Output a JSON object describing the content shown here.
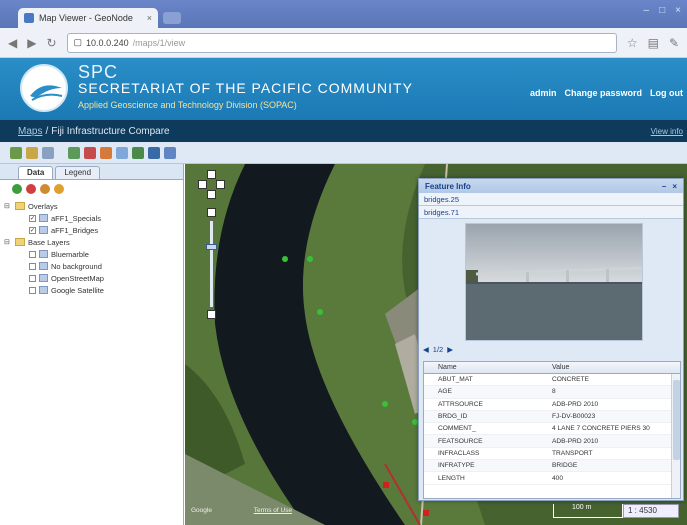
{
  "browser": {
    "tab_title": "Map Viewer - GeoNode",
    "tab_close": "×",
    "url_host": "10.0.0.240",
    "url_path": "/maps/1/view",
    "window_controls": [
      "–",
      "□",
      "×"
    ]
  },
  "banner": {
    "abbr": "SPC",
    "name": "Secretariat of the Pacific Community",
    "division": "Applied Geoscience and Technology Division (SOPAC)",
    "user_links": [
      "admin",
      "Change password",
      "Log out"
    ]
  },
  "breadcrumb": {
    "root": "Maps",
    "separator": "/",
    "current": "Fiji Infrastructure Compare",
    "right_link": "View info"
  },
  "left_panel": {
    "tabs": [
      "Data",
      "Legend"
    ],
    "tree": [
      {
        "label": "Overlays",
        "level": 0,
        "type": "folder"
      },
      {
        "label": "aFF1_Specials",
        "level": 1,
        "type": "layer",
        "checked": true
      },
      {
        "label": "aFF1_Bridges",
        "level": 1,
        "type": "layer",
        "checked": true
      },
      {
        "label": "Base Layers",
        "level": 0,
        "type": "folder"
      },
      {
        "label": "Bluemarble",
        "level": 1,
        "type": "base"
      },
      {
        "label": "No background",
        "level": 1,
        "type": "base"
      },
      {
        "label": "OpenStreetMap",
        "level": 1,
        "type": "base"
      },
      {
        "label": "Google Satellite",
        "level": 1,
        "type": "base"
      }
    ]
  },
  "map": {
    "attribution_prefix": "Google",
    "attribution_link": "Terms of Use",
    "scale_label": "1 : 4530",
    "scale_bar_text": "100 m"
  },
  "feature_info": {
    "title": "Feature Info",
    "rows": [
      "bridges.25",
      "bridges.71"
    ],
    "pager": "1/2",
    "grid_headers": [
      "Name",
      "Value"
    ],
    "grid_rows": [
      {
        "name": "ABUT_MAT",
        "value": "CONCRETE"
      },
      {
        "name": "AGE",
        "value": "8"
      },
      {
        "name": "ATTRSOURCE",
        "value": "ADB-PRD 2010"
      },
      {
        "name": "BRDG_ID",
        "value": "FJ-DV-B00023"
      },
      {
        "name": "COMMENT_",
        "value": "4 LANE 7 CONCRETE PIERS 30"
      },
      {
        "name": "FEATSOURCE",
        "value": "ADB-PRD 2010"
      },
      {
        "name": "INFRACLASS",
        "value": "TRANSPORT"
      },
      {
        "name": "INFRATYPE",
        "value": "BRIDGE"
      },
      {
        "name": "LENGTH",
        "value": "400"
      }
    ]
  }
}
